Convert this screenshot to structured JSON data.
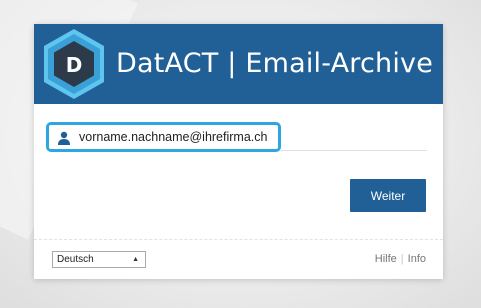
{
  "app": {
    "title": "DatACT | Email-Archive",
    "logo_letter": "D",
    "header_color": "#215f97",
    "accent_color": "#2ea6df"
  },
  "login": {
    "email_value": "vorname.nachname@ihrefirma.ch",
    "user_icon": "user-icon",
    "next_label": "Weiter"
  },
  "footer": {
    "language_selected": "Deutsch",
    "help_label": "Hilfe",
    "separator": "|",
    "info_label": "Info"
  }
}
